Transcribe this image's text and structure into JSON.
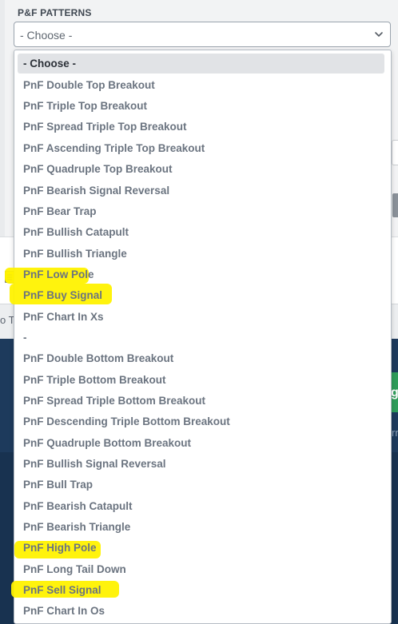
{
  "section_label": "P&F PATTERNS",
  "select": {
    "value": "- Choose -"
  },
  "options": [
    "- Choose -",
    "PnF Double Top Breakout",
    "PnF Triple Top Breakout",
    "PnF Spread Triple Top Breakout",
    "PnF Ascending Triple Top Breakout",
    "PnF Quadruple Top Breakout",
    "PnF Bearish Signal Reversal",
    "PnF Bear Trap",
    "PnF Bullish Catapult",
    "PnF Bullish Triangle",
    "PnF Low Pole",
    "PnF Buy Signal",
    "PnF Chart In Xs",
    "-",
    "PnF Double Bottom Breakout",
    "PnF Triple Bottom Breakout",
    "PnF Spread Triple Bottom Breakout",
    "PnF Descending Triple Bottom Breakout",
    "PnF Quadruple Bottom Breakout",
    "PnF Bullish Signal Reversal",
    "PnF Bull Trap",
    "PnF Bearish Catapult",
    "PnF Bearish Triangle",
    "PnF High Pole",
    "PnF Long Tail Down",
    "PnF Sell Signal",
    "PnF Chart In Os"
  ],
  "fragments": {
    "left": "o To",
    "green_button": "g",
    "right": "rr"
  },
  "colors": {
    "highlight": "#fff200",
    "dark_panel": "#1d3a5c",
    "green_button": "#2f9c5a"
  }
}
